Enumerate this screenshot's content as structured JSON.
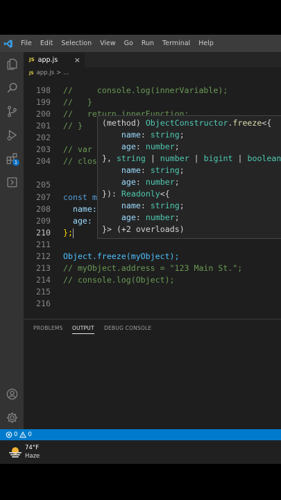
{
  "menubar": {
    "items": [
      "File",
      "Edit",
      "Selection",
      "View",
      "Go",
      "Run",
      "Terminal",
      "Help"
    ]
  },
  "activity_bar": {
    "icons": [
      "explorer-icon",
      "search-icon",
      "source-control-icon",
      "run-debug-icon",
      "extensions-icon",
      "remote-icon",
      "account-icon",
      "settings-gear-icon"
    ],
    "extensions_badge": "1"
  },
  "tab": {
    "file_icon": "JS",
    "label": "app.js",
    "close": "×"
  },
  "breadcrumb": {
    "file_icon": "JS",
    "file": "app.js",
    "sep": ">",
    "rest": "..."
  },
  "editor": {
    "lines": [
      {
        "num": "198",
        "text": "//     console.log(innerVariable);"
      },
      {
        "num": "199",
        "text": "//   }"
      },
      {
        "num": "200",
        "text": "//   return innerFunction;"
      },
      {
        "num": "201",
        "text": "// }"
      },
      {
        "num": "202",
        "text": ""
      },
      {
        "num": "203",
        "text": "// var"
      },
      {
        "num": "204",
        "text": "// clos"
      },
      {
        "num": "205",
        "text": ""
      },
      {
        "num": "207",
        "text": "const m"
      },
      {
        "num": "208",
        "text": "  name:"
      },
      {
        "num": "209",
        "text": "  age:"
      },
      {
        "num": "210",
        "text": "};"
      },
      {
        "num": "211",
        "text": ""
      },
      {
        "num": "212",
        "text": "Object.freeze(myObject);"
      },
      {
        "num": "213",
        "text": "// myObject.address = \"123 Main St.\";"
      },
      {
        "num": "214",
        "text": "// console.log(Object);"
      },
      {
        "num": "215",
        "text": ""
      },
      {
        "num": "216",
        "text": ""
      }
    ],
    "active_line": "210"
  },
  "hover": {
    "l1a": "(method) ",
    "l1b": "ObjectConstructor",
    "l1c": ".",
    "l1d": "freeze",
    "l1e": "<{",
    "name_prop": "name",
    "age_prop": "age",
    "string_t": "string",
    "number_t": "number",
    "l4a": "}, ",
    "l4b": "string",
    "l4c": " | ",
    "l4d": "number",
    "l4e": " | ",
    "l4f": "bigint",
    "l4g": " | ",
    "l4h": "boolean",
    "l7a": "}): ",
    "l7b": "Readonly",
    "l7c": "<{",
    "l10a": "}> ",
    "l10b": "(+2 overloads)"
  },
  "panel": {
    "tabs": [
      "PROBLEMS",
      "OUTPUT",
      "DEBUG CONSOLE"
    ],
    "active_tab": "OUTPUT"
  },
  "statusbar": {
    "errors": "0",
    "warnings": "0"
  },
  "taskbar": {
    "temperature": "74°F",
    "condition": "Haze"
  },
  "colors": {
    "accent": "#007acc",
    "activity": "#333333",
    "editor_bg": "#1e1e1e"
  }
}
